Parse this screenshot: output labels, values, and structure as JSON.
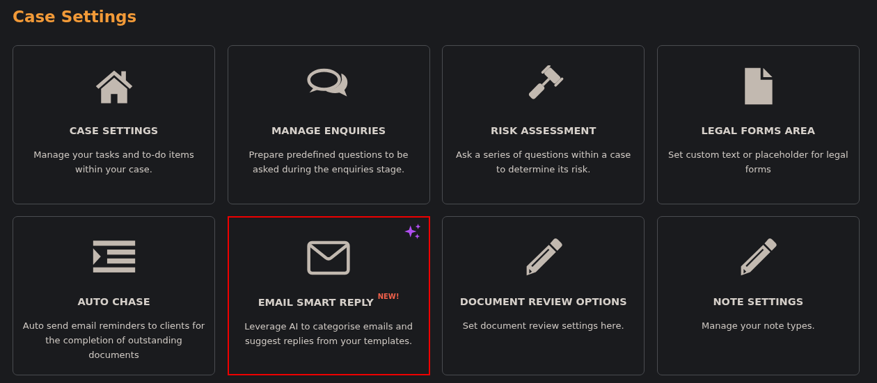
{
  "page_title": "Case Settings",
  "cards": [
    {
      "kind": "home",
      "title": "CASE SETTINGS",
      "description": "Manage your tasks and to-do items within your case.",
      "highlighted": false,
      "sparkle": false
    },
    {
      "kind": "chat",
      "title": "MANAGE ENQUIRIES",
      "description": "Prepare predefined questions to be asked during the enquiries stage.",
      "highlighted": false,
      "sparkle": false
    },
    {
      "kind": "gavel",
      "title": "RISK ASSESSMENT",
      "description": "Ask a series of questions within a case to determine its risk.",
      "highlighted": false,
      "sparkle": false
    },
    {
      "kind": "file",
      "title": "LEGAL FORMS AREA",
      "description": "Set custom text or placeholder for legal forms",
      "highlighted": false,
      "sparkle": false
    },
    {
      "kind": "indent",
      "title": "AUTO CHASE",
      "description": "Auto send email reminders to clients for the completion of outstanding documents",
      "highlighted": false,
      "sparkle": false
    },
    {
      "kind": "envelope",
      "title": "EMAIL SMART REPLY",
      "badge": "NEW!",
      "description": "Leverage AI to categorise emails and suggest replies from your templates.",
      "highlighted": true,
      "sparkle": true
    },
    {
      "kind": "pencil",
      "title": "DOCUMENT REVIEW OPTIONS",
      "description": "Set document review settings here.",
      "highlighted": false,
      "sparkle": false
    },
    {
      "kind": "pencil",
      "title": "NOTE SETTINGS",
      "description": "Manage your note types.",
      "highlighted": false,
      "sparkle": false
    }
  ]
}
